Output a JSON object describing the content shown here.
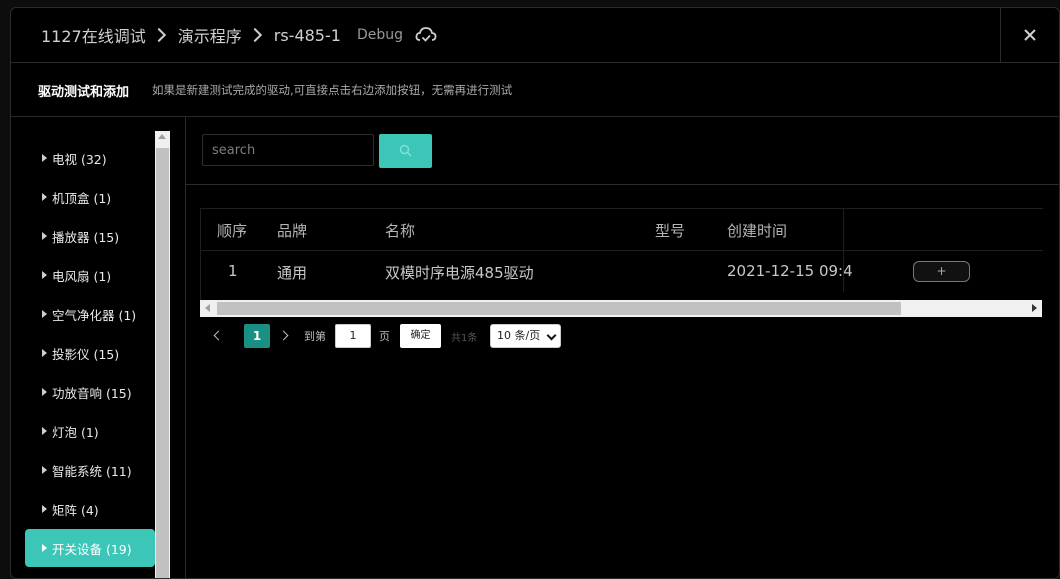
{
  "breadcrumb": {
    "items": [
      "1127在线调试",
      "演示程序",
      "rs-485-1"
    ],
    "tag": "Debug"
  },
  "subbar": {
    "title": "驱动测试和添加",
    "hint": "如果是新建测试完成的驱动,可直接点击右边添加按钮，无需再进行测试"
  },
  "sidebar": {
    "items": [
      {
        "label": "电视 (32)"
      },
      {
        "label": "机顶盒 (1)"
      },
      {
        "label": "播放器 (15)"
      },
      {
        "label": "电风扇 (1)"
      },
      {
        "label": "空气净化器 (1)"
      },
      {
        "label": "投影仪 (15)"
      },
      {
        "label": "功放音响 (15)"
      },
      {
        "label": "灯泡 (1)"
      },
      {
        "label": "智能系统 (11)"
      },
      {
        "label": "矩阵 (4)"
      },
      {
        "label": "开关设备 (19)"
      }
    ],
    "active_index": 10
  },
  "search": {
    "placeholder": "search",
    "value": ""
  },
  "table": {
    "columns": [
      "顺序",
      "品牌",
      "名称",
      "型号",
      "创建时间"
    ],
    "rows": [
      {
        "order": "1",
        "brand": "通用",
        "name": "双模时序电源485驱动",
        "model": "",
        "created": "2021-12-15 09:4",
        "action": "+"
      }
    ]
  },
  "pagination": {
    "current_page": "1",
    "goto_label": "到第",
    "goto_value": "1",
    "page_unit": "页",
    "confirm_label": "确定",
    "total": "共1条",
    "page_size": "10 条/页"
  },
  "colors": {
    "accent": "#3cc6b8",
    "page_active": "#1a8f83",
    "background": "#000000"
  }
}
